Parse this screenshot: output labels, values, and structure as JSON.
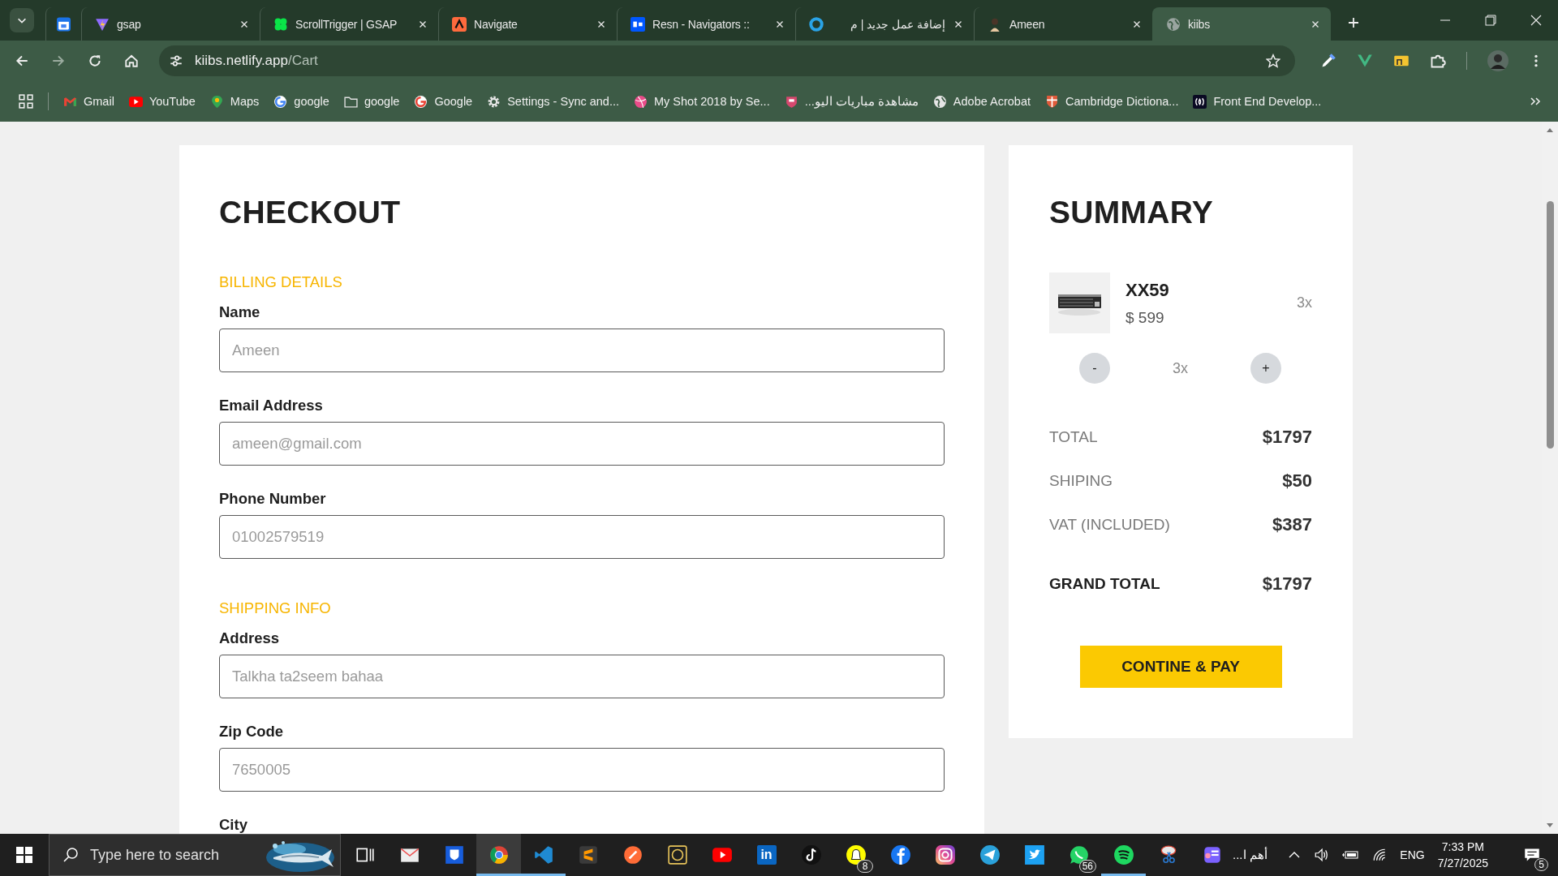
{
  "browser": {
    "tabs": [
      {
        "selected": false
      },
      {
        "title": "gsap",
        "selected": false
      },
      {
        "title": "ScrollTrigger | GSAP",
        "selected": false
      },
      {
        "title": "Navigate",
        "selected": false
      },
      {
        "title": "Resn - Navigators ::",
        "selected": false
      },
      {
        "title": "إضافة عمل جديد | م",
        "selected": false
      },
      {
        "title": "Ameen",
        "selected": false
      },
      {
        "title": "kiibs",
        "selected": true
      }
    ],
    "address": {
      "host": "kiibs.netlify.app",
      "path": "/Cart"
    },
    "bookmarks": [
      {
        "title": "Gmail"
      },
      {
        "title": "YouTube"
      },
      {
        "title": "Maps"
      },
      {
        "title": "google"
      },
      {
        "title": "google"
      },
      {
        "title": "Google"
      },
      {
        "title": "Settings - Sync and..."
      },
      {
        "title": "My Shot 2018 by Se..."
      },
      {
        "title": "مشاهدة مباريات اليو..."
      },
      {
        "title": "Adobe Acrobat"
      },
      {
        "title": "Cambridge Dictiona..."
      },
      {
        "title": "Front End Develop..."
      }
    ]
  },
  "checkout": {
    "title": "CHECKOUT",
    "sections": [
      {
        "heading": "BILLING DETAILS",
        "fields": [
          {
            "label": "Name",
            "placeholder": "Ameen"
          },
          {
            "label": "Email Address",
            "placeholder": "ameen@gmail.com"
          },
          {
            "label": "Phone Number",
            "placeholder": "01002579519"
          }
        ]
      },
      {
        "heading": "SHIPPING INFO",
        "fields": [
          {
            "label": "Address",
            "placeholder": "Talkha ta2seem bahaa"
          },
          {
            "label": "Zip Code",
            "placeholder": "7650005"
          },
          {
            "label": "City"
          }
        ]
      }
    ]
  },
  "summary": {
    "title": "SUMMARY",
    "item": {
      "kind": "picture",
      "name": "XX59",
      "price": "$ 599",
      "quantity": "3x",
      "minus": "-",
      "stepper_quantity": "3x",
      "plus": "+"
    },
    "totals": [
      {
        "kind": "line",
        "label": "TOTAL",
        "value": "$1797"
      },
      {
        "kind": "line",
        "label": "SHIPING",
        "value": "$50"
      },
      {
        "kind": "line",
        "label": "VAT (INCLUDED)",
        "value": "$387"
      },
      {
        "kind": "grand",
        "label": "GRAND TOTAL",
        "value": "$1797"
      }
    ],
    "button": "CONTINE & PAY"
  },
  "taskbar": {
    "search_placeholder": "Type here to search",
    "apps": [
      {
        "selected": false,
        "running": false
      },
      {
        "selected": false,
        "running": false
      },
      {
        "selected": false,
        "running": false
      },
      {
        "selected": true,
        "running": true
      },
      {
        "selected": false,
        "running": true
      },
      {
        "selected": false,
        "running": false
      },
      {
        "selected": false,
        "running": false
      },
      {
        "selected": false,
        "running": false
      },
      {
        "selected": false,
        "running": false
      },
      {
        "selected": false,
        "running": false,
        "label": "in"
      },
      {
        "selected": false,
        "running": false
      },
      {
        "selected": false,
        "running": false,
        "badge": "8"
      },
      {
        "selected": false,
        "running": false
      },
      {
        "selected": false,
        "running": false
      },
      {
        "selected": false,
        "running": false
      },
      {
        "selected": false,
        "running": false
      },
      {
        "selected": false,
        "running": false,
        "badge": "56"
      },
      {
        "selected": false,
        "running": true
      },
      {
        "selected": false,
        "running": false
      },
      {
        "selected": false,
        "running": false,
        "title": "أهم ا..."
      }
    ],
    "language": "ENG",
    "time": "7:33 PM",
    "date": "7/27/2025",
    "notifications": "5"
  }
}
